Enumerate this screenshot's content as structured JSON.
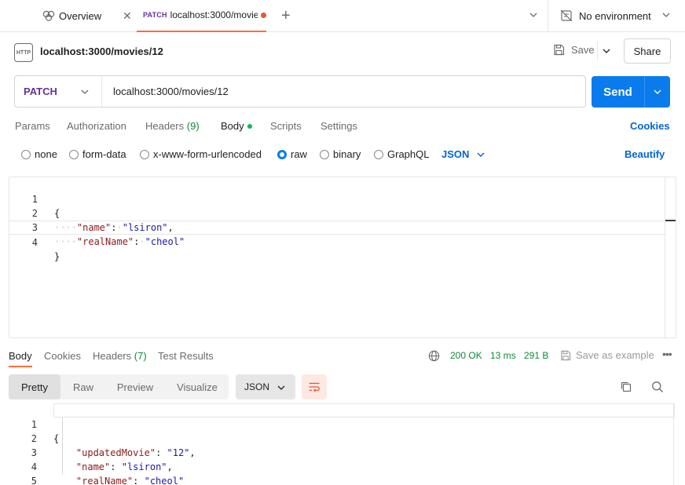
{
  "tabs": {
    "overview_label": "Overview",
    "overview_close": "✕",
    "active_method": "PATCH",
    "active_url": "localhost:3000/movie",
    "new_tab": "+"
  },
  "environment": {
    "label": "No environment"
  },
  "request": {
    "title": "localhost:3000/movies/12",
    "icon_text": "HTTP",
    "save_label": "Save",
    "share_label": "Share",
    "method": "PATCH",
    "url": "localhost:3000/movies/12",
    "send_label": "Send"
  },
  "request_tabs": {
    "params": "Params",
    "authorization": "Authorization",
    "headers": "Headers",
    "headers_count": "(9)",
    "body": "Body",
    "scripts": "Scripts",
    "settings": "Settings",
    "cookies": "Cookies"
  },
  "body_types": {
    "none": "none",
    "form_data": "form-data",
    "urlencoded": "x-www-form-urlencoded",
    "raw": "raw",
    "binary": "binary",
    "graphql": "GraphQL",
    "selected": "raw",
    "format": "JSON",
    "beautify": "Beautify"
  },
  "request_body": {
    "line_numbers": [
      "1",
      "2",
      "3",
      "4"
    ],
    "open": "{",
    "close": "}",
    "name_key": "\"name\"",
    "name_val": "\"lsiron\"",
    "realname_key": "\"realName\"",
    "realname_val": "\"cheol\""
  },
  "response_tabs": {
    "body": "Body",
    "cookies": "Cookies",
    "headers": "Headers",
    "headers_count": "(7)",
    "test_results": "Test Results"
  },
  "response_meta": {
    "status": "200 OK",
    "time": "13 ms",
    "size": "291 B",
    "save_example": "Save as example",
    "more": "•••"
  },
  "response_view": {
    "pretty": "Pretty",
    "raw": "Raw",
    "preview": "Preview",
    "visualize": "Visualize",
    "format": "JSON"
  },
  "response_body": {
    "line_numbers": [
      "1",
      "2",
      "3",
      "4",
      "5"
    ],
    "open": "{",
    "close": "}",
    "updated_key": "\"updatedMovie\"",
    "updated_val": "\"12\"",
    "name_key": "\"name\"",
    "name_val": "\"lsiron\"",
    "realname_key": "\"realName\"",
    "realname_val": "\"cheol\""
  },
  "colors": {
    "accent_orange": "#ff6c37",
    "send_blue": "#097bed",
    "link_blue": "#0265d2",
    "method_purple": "#623497",
    "status_green": "#0e8a3a"
  }
}
